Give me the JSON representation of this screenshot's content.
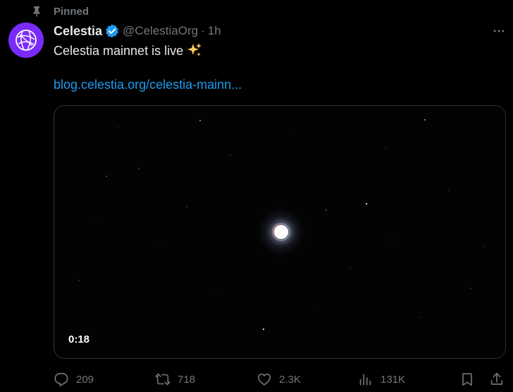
{
  "pinned": {
    "label": "Pinned",
    "icon": "pin-icon"
  },
  "author": {
    "display_name": "Celestia",
    "handle": "@CelestiaOrg",
    "separator": "·",
    "time": "1h",
    "verified": true,
    "avatar_color": "#7b2bf9"
  },
  "tweet": {
    "text": "Celestia mainnet is live",
    "emoji_icon": "sparkles-icon",
    "link_text": "blog.celestia.org/celestia-mainn..."
  },
  "media": {
    "duration": "0:18",
    "border_color": "#2f3336"
  },
  "actions": {
    "replies": "209",
    "reposts": "718",
    "likes": "2.3K",
    "views": "131K",
    "icons": [
      "reply-icon",
      "repost-icon",
      "like-icon",
      "views-icon",
      "bookmark-icon",
      "share-icon"
    ]
  },
  "colors": {
    "background": "#000000",
    "text_primary": "#e7e9ea",
    "text_secondary": "#71767b",
    "link": "#1d9bf0",
    "verified": "#1d9bf0"
  }
}
